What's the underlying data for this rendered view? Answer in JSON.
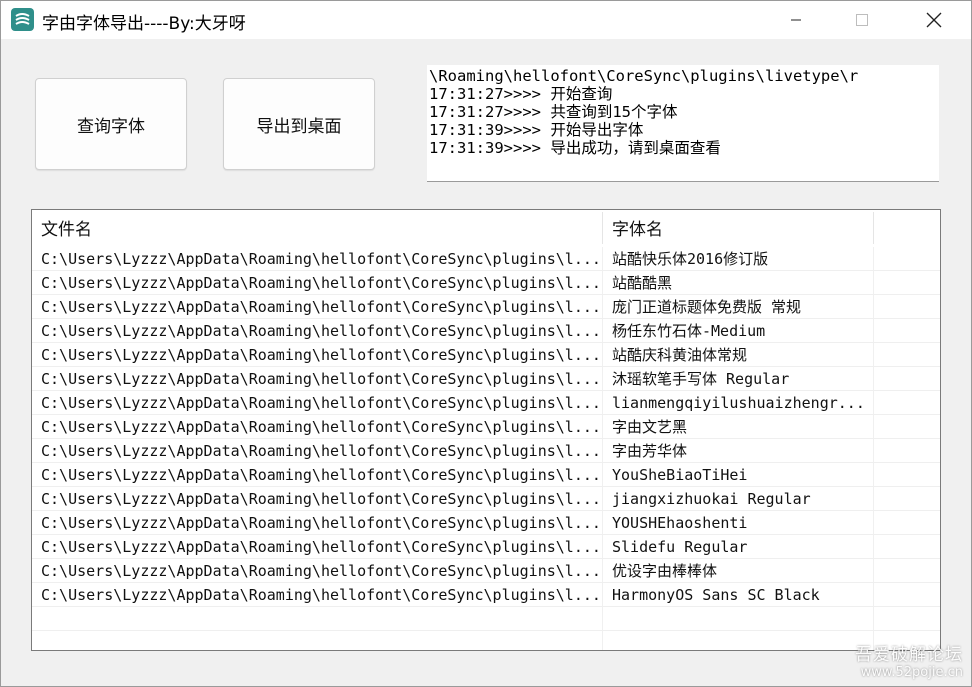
{
  "window": {
    "title": "字由字体导出----By:大牙呀",
    "minimize_icon": "minimize-icon",
    "maximize_icon": "maximize-icon",
    "close_icon": "close-icon"
  },
  "buttons": {
    "query_label": "查询字体",
    "export_label": "导出到桌面"
  },
  "log": {
    "lines": [
      "\\Roaming\\hellofont\\CoreSync\\plugins\\livetype\\r",
      "17:31:27>>>> 开始查询",
      "17:31:27>>>> 共查询到15个字体",
      "17:31:39>>>> 开始导出字体",
      "17:31:39>>>> 导出成功，请到桌面查看"
    ]
  },
  "table": {
    "headers": [
      "文件名",
      "字体名"
    ],
    "rows": [
      [
        "C:\\Users\\Lyzzz\\AppData\\Roaming\\hellofont\\CoreSync\\plugins\\l...",
        "站酷快乐体2016修订版"
      ],
      [
        "C:\\Users\\Lyzzz\\AppData\\Roaming\\hellofont\\CoreSync\\plugins\\l...",
        "站酷酷黑"
      ],
      [
        "C:\\Users\\Lyzzz\\AppData\\Roaming\\hellofont\\CoreSync\\plugins\\l...",
        "庞门正道标题体免费版 常规"
      ],
      [
        "C:\\Users\\Lyzzz\\AppData\\Roaming\\hellofont\\CoreSync\\plugins\\l...",
        "杨任东竹石体-Medium"
      ],
      [
        "C:\\Users\\Lyzzz\\AppData\\Roaming\\hellofont\\CoreSync\\plugins\\l...",
        "站酷庆科黄油体常规"
      ],
      [
        "C:\\Users\\Lyzzz\\AppData\\Roaming\\hellofont\\CoreSync\\plugins\\l...",
        "沐瑶软笔手写体 Regular"
      ],
      [
        "C:\\Users\\Lyzzz\\AppData\\Roaming\\hellofont\\CoreSync\\plugins\\l...",
        "lianmengqiyilushuaizhengr..."
      ],
      [
        "C:\\Users\\Lyzzz\\AppData\\Roaming\\hellofont\\CoreSync\\plugins\\l...",
        "字由文艺黑"
      ],
      [
        "C:\\Users\\Lyzzz\\AppData\\Roaming\\hellofont\\CoreSync\\plugins\\l...",
        "字由芳华体"
      ],
      [
        "C:\\Users\\Lyzzz\\AppData\\Roaming\\hellofont\\CoreSync\\plugins\\l...",
        "YouSheBiaoTiHei"
      ],
      [
        "C:\\Users\\Lyzzz\\AppData\\Roaming\\hellofont\\CoreSync\\plugins\\l...",
        "jiangxizhuokai Regular"
      ],
      [
        "C:\\Users\\Lyzzz\\AppData\\Roaming\\hellofont\\CoreSync\\plugins\\l...",
        "YOUSHEhaoshenti"
      ],
      [
        "C:\\Users\\Lyzzz\\AppData\\Roaming\\hellofont\\CoreSync\\plugins\\l...",
        "Slidefu Regular"
      ],
      [
        "C:\\Users\\Lyzzz\\AppData\\Roaming\\hellofont\\CoreSync\\plugins\\l...",
        "优设字由棒棒体"
      ],
      [
        "C:\\Users\\Lyzzz\\AppData\\Roaming\\hellofont\\CoreSync\\plugins\\l...",
        "HarmonyOS Sans SC Black"
      ]
    ]
  },
  "watermark": {
    "line1": "吾爱破解论坛",
    "line2": "www.52pojie.cn"
  },
  "colors": {
    "window_bg": "#f0f0f0",
    "titlebar_bg": "#ffffff",
    "icon_accent": "#2f8f8a"
  }
}
